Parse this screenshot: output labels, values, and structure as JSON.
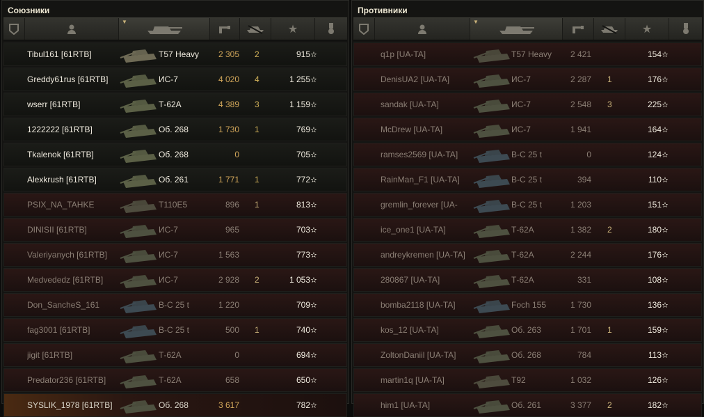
{
  "allies": {
    "title": "Союзники",
    "rows": [
      {
        "name": "Tibul161 [61RTB]",
        "tank": "T57 Heavy",
        "damage": "2 305",
        "frags": "2",
        "xp": "915",
        "state": "alive",
        "tank_color": "#6e6a55"
      },
      {
        "name": "Greddy61rus [61RTB]",
        "tank": "ИС-7",
        "damage": "4 020",
        "frags": "4",
        "xp": "1 255",
        "state": "alive",
        "tank_color": "#5b6046"
      },
      {
        "name": "wserr [61RTB]",
        "tank": "Т-62А",
        "damage": "4 389",
        "frags": "3",
        "xp": "1 159",
        "state": "alive",
        "tank_color": "#5b6046"
      },
      {
        "name": "1222222 [61RTB]",
        "tank": "Об. 268",
        "damage": "1 730",
        "frags": "1",
        "xp": "769",
        "state": "alive",
        "tank_color": "#5b6046"
      },
      {
        "name": "Tkalenok [61RTB]",
        "tank": "Об. 268",
        "damage": "0",
        "frags": "",
        "xp": "705",
        "state": "alive",
        "tank_color": "#5b6046"
      },
      {
        "name": "Alexkrush [61RTB]",
        "tank": "Об. 261",
        "damage": "1 771",
        "frags": "1",
        "xp": "772",
        "state": "alive",
        "tank_color": "#5b6046"
      },
      {
        "name": "PSIX_NA_TAHKE",
        "tank": "T110E5",
        "damage": "896",
        "frags": "1",
        "xp": "813",
        "state": "dead",
        "tank_color": "#4e4c3e"
      },
      {
        "name": "DINISII [61RTB]",
        "tank": "ИС-7",
        "damage": "965",
        "frags": "",
        "xp": "703",
        "state": "dead",
        "tank_color": "#4e5140"
      },
      {
        "name": "Valeriyanych [61RTB]",
        "tank": "ИС-7",
        "damage": "1 563",
        "frags": "",
        "xp": "773",
        "state": "dead",
        "tank_color": "#4e5140"
      },
      {
        "name": "Medvededz [61RTB]",
        "tank": "ИС-7",
        "damage": "2 928",
        "frags": "2",
        "xp": "1 053",
        "state": "dead",
        "tank_color": "#4e5140"
      },
      {
        "name": "Don_SancheS_161",
        "tank": "B-C 25 t",
        "damage": "1 220",
        "frags": "",
        "xp": "709",
        "state": "dead",
        "tank_color": "#3d4a52"
      },
      {
        "name": "fag3001 [61RTB]",
        "tank": "B-C 25 t",
        "damage": "500",
        "frags": "1",
        "xp": "740",
        "state": "dead",
        "tank_color": "#3d4a52"
      },
      {
        "name": "jigit [61RTB]",
        "tank": "Т-62А",
        "damage": "0",
        "frags": "",
        "xp": "694",
        "state": "dead",
        "tank_color": "#4e5140"
      },
      {
        "name": "Predator236 [61RTB]",
        "tank": "Т-62А",
        "damage": "658",
        "frags": "",
        "xp": "650",
        "state": "dead",
        "tank_color": "#4e5140"
      },
      {
        "name": "SYSLIK_1978 [61RTB]",
        "tank": "Об. 268",
        "damage": "3 617",
        "frags": "",
        "xp": "782",
        "state": "self",
        "tank_color": "#4e5140"
      }
    ]
  },
  "enemies": {
    "title": "Противники",
    "rows": [
      {
        "name": "q1p [UA-TA]",
        "tank": "T57 Heavy",
        "damage": "2 421",
        "frags": "",
        "xp": "154",
        "state": "dead",
        "tank_color": "#4e4c3e"
      },
      {
        "name": "DenisUA2 [UA-TA]",
        "tank": "ИС-7",
        "damage": "2 287",
        "frags": "1",
        "xp": "176",
        "state": "dead",
        "tank_color": "#4e5140"
      },
      {
        "name": "sandak [UA-TA]",
        "tank": "ИС-7",
        "damage": "2 548",
        "frags": "3",
        "xp": "225",
        "state": "dead",
        "tank_color": "#4e5140"
      },
      {
        "name": "McDrew [UA-TA]",
        "tank": "ИС-7",
        "damage": "1 941",
        "frags": "",
        "xp": "164",
        "state": "dead",
        "tank_color": "#4e5140"
      },
      {
        "name": "ramses2569 [UA-TA]",
        "tank": "B-C 25 t",
        "damage": "0",
        "frags": "",
        "xp": "124",
        "state": "dead",
        "tank_color": "#3d4a52"
      },
      {
        "name": "RainMan_F1 [UA-TA]",
        "tank": "B-C 25 t",
        "damage": "394",
        "frags": "",
        "xp": "110",
        "state": "dead",
        "tank_color": "#3d4a52"
      },
      {
        "name": "gremlin_forever [UA-",
        "tank": "B-C 25 t",
        "damage": "1 203",
        "frags": "",
        "xp": "151",
        "state": "dead",
        "tank_color": "#3d4a52"
      },
      {
        "name": "ice_one1 [UA-TA]",
        "tank": "Т-62А",
        "damage": "1 382",
        "frags": "2",
        "xp": "180",
        "state": "dead",
        "tank_color": "#4e5140"
      },
      {
        "name": "andreykremen [UA-TA]",
        "tank": "Т-62А",
        "damage": "2 244",
        "frags": "",
        "xp": "176",
        "state": "dead",
        "tank_color": "#4e5140"
      },
      {
        "name": "280867 [UA-TA]",
        "tank": "Т-62А",
        "damage": "331",
        "frags": "",
        "xp": "108",
        "state": "dead",
        "tank_color": "#4e5140"
      },
      {
        "name": "bomba2118 [UA-TA]",
        "tank": "Foch 155",
        "damage": "1 730",
        "frags": "",
        "xp": "136",
        "state": "dead",
        "tank_color": "#3d4a52"
      },
      {
        "name": "kos_12 [UA-TA]",
        "tank": "Об. 263",
        "damage": "1 701",
        "frags": "1",
        "xp": "159",
        "state": "dead",
        "tank_color": "#4e5140"
      },
      {
        "name": "ZoltonDaniil [UA-TA]",
        "tank": "Об. 268",
        "damage": "784",
        "frags": "",
        "xp": "113",
        "state": "dead",
        "tank_color": "#4e5140"
      },
      {
        "name": "martin1q [UA-TA]",
        "tank": "T92",
        "damage": "1 032",
        "frags": "",
        "xp": "126",
        "state": "dead",
        "tank_color": "#4e4c3e"
      },
      {
        "name": "him1 [UA-TA]",
        "tank": "Об. 261",
        "damage": "3 377",
        "frags": "2",
        "xp": "182",
        "state": "dead",
        "tank_color": "#4e5140"
      }
    ]
  },
  "header_icons": [
    "platoon-icon",
    "player-icon",
    "vehicle-icon",
    "damage-icon",
    "frags-icon",
    "xp-star-icon",
    "medal-icon"
  ],
  "star_glyph": "✫"
}
